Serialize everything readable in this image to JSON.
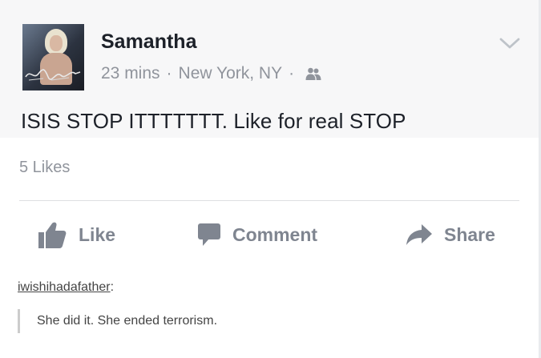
{
  "post": {
    "author_name": "Samantha",
    "time": "23 mins",
    "separator": "·",
    "location": "New York, NY",
    "audience_icon": "friends-icon",
    "text": "ISIS STOP ITTTTTTT. Like for real STOP",
    "likes_count": "5 Likes",
    "menu_icon": "chevron-down-icon"
  },
  "actions": {
    "like_label": "Like",
    "comment_label": "Comment",
    "share_label": "Share"
  },
  "reblog": {
    "username": "iwishihadafather",
    "colon": ":",
    "quote_text": "She did it. She ended terrorism."
  },
  "colors": {
    "name_text": "#1d2129",
    "meta_text": "#90949c",
    "action_text": "#7f8590",
    "divider": "#dddfe2"
  }
}
